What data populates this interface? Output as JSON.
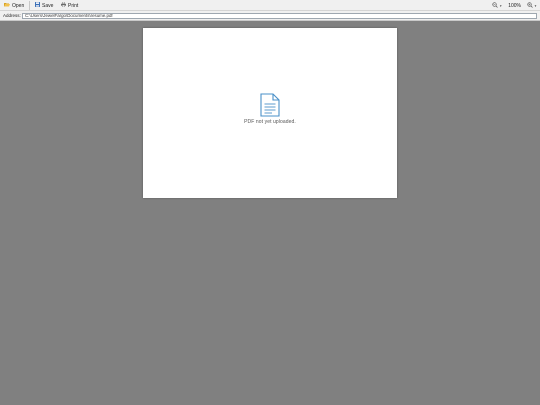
{
  "toolbar": {
    "open_label": "Open",
    "save_label": "Save",
    "print_label": "Print",
    "zoom_level": "100%",
    "icons": {
      "open": "folder-open-icon",
      "save": "floppy-disk-icon",
      "print": "printer-icon",
      "zoom_out": "zoom-out-icon",
      "zoom_in": "zoom-in-icon"
    }
  },
  "address": {
    "label": "Address:",
    "value": "C:\\Users\\JewelFargo\\Documents\\resume.pdf"
  },
  "viewer": {
    "message": "PDF not yet uploaded.",
    "icon": "document-icon",
    "accent_color": "#4a90c8"
  },
  "colors": {
    "background": "#808080",
    "toolbar": "#f0f0f0",
    "page": "#ffffff"
  }
}
